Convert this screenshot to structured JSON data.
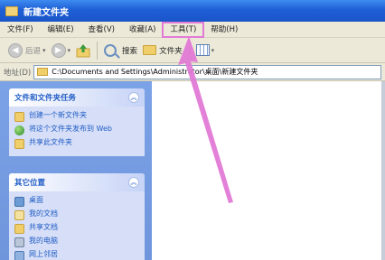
{
  "window": {
    "title": "新建文件夹"
  },
  "menu": [
    "文件(F)",
    "编辑(E)",
    "查看(V)",
    "收藏(A)",
    "工具(T)",
    "帮助(H)"
  ],
  "toolbar": {
    "back_label": "后退",
    "search_label": "搜索",
    "folders_label": "文件夹"
  },
  "address": {
    "label": "地址(D)",
    "path": "C:\\Documents and Settings\\Administrator\\桌面\\新建文件夹"
  },
  "panels": {
    "tasks": {
      "title": "文件和文件夹任务",
      "items": [
        "创建一个新文件夹",
        "将这个文件夹发布到 Web",
        "共享此文件夹"
      ]
    },
    "places": {
      "title": "其它位置",
      "items": [
        "桌面",
        "我的文档",
        "共享文档",
        "我的电脑",
        "网上邻居"
      ]
    }
  },
  "highlight": {
    "color": "#e27ad6"
  }
}
